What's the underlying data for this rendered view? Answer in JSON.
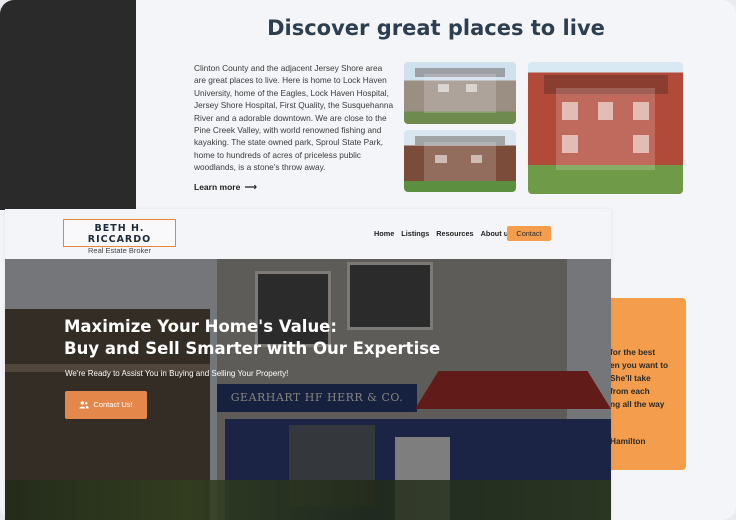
{
  "discover": {
    "title": "Discover great places to live",
    "paragraph": "Clinton County and the adjacent Jersey Shore area are great places to live. Here is home to Lock Haven University, home of the Eagles, Lock Haven Hospital, Jersey Shore Hospital, First Quality, the Susquehanna River and a adorable downtown. We are close to the Pine Creek Valley, with world renowned fishing and kayaking. The state owned park, Sproul State Park, home to hundreds of acres of priceless public woodlands, is a stone's throw away.",
    "learn_more": "Learn more",
    "arrow_icon": "arrow-right-icon"
  },
  "testimonial": {
    "quote": "for the best\nen you want to\nShe'll take\nfrom each\nng all the way",
    "author": "Hamilton"
  },
  "header": {
    "logo_name": "BETH H. RICCARDO",
    "logo_tagline": "Real Estate Broker",
    "nav": [
      "Home",
      "Listings",
      "Resources",
      "About us"
    ],
    "contact_label": "Contact"
  },
  "hero": {
    "title_line1": "Maximize Your Home's Value:",
    "title_line2": "Buy and Sell Smarter with Our Expertise",
    "subtitle": "We're Ready to Assist You in Buying and Selling Your Property!",
    "cta_label": "Contact Us!",
    "cta_icon": "users-icon",
    "storefront_sign": "GEARHART HF HERR & CO. INC."
  },
  "colors": {
    "accent_orange": "#f49d4c",
    "heading_navy": "#2c3e50",
    "dark_panel": "#2a2a2a"
  }
}
